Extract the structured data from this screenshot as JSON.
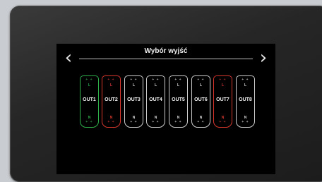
{
  "screen": {
    "title": "Wybór wyjść",
    "prev_symbol": "‹",
    "next_symbol": "›"
  },
  "pin_labels": {
    "top": "+ +",
    "line": "L",
    "neutral": "N",
    "bottom": "+ +"
  },
  "colors": {
    "default": "#cfcfcf",
    "green": "#2fb24a",
    "red": "#d8382c"
  },
  "outputs": [
    {
      "label": "OUT1",
      "state": "green"
    },
    {
      "label": "OUT2",
      "state": "red"
    },
    {
      "label": "OUT3",
      "state": "default"
    },
    {
      "label": "OUT4",
      "state": "default"
    },
    {
      "label": "OUT5",
      "state": "default"
    },
    {
      "label": "OUT6",
      "state": "default"
    },
    {
      "label": "OUT7",
      "state": "red"
    },
    {
      "label": "OUT8",
      "state": "default"
    }
  ]
}
